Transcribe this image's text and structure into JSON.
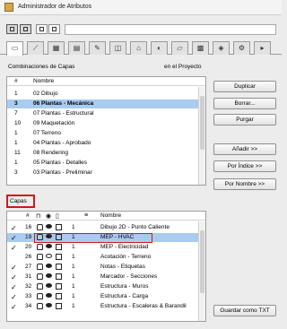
{
  "window": {
    "title": "Administrador de Atributos"
  },
  "toolbar": {
    "search_value": ""
  },
  "combinations": {
    "section_title": "Combinaciones de Capas",
    "in_project": "en el Proyecto",
    "header_hash": "#",
    "header_name": "Nombre",
    "rows": [
      {
        "num": "1",
        "name": "02 Dibujo"
      },
      {
        "num": "3",
        "name": "06 Plantas - Mecánica"
      },
      {
        "num": "7",
        "name": "07 Plantas - Estructural"
      },
      {
        "num": "10",
        "name": "09 Maquetación"
      },
      {
        "num": "1",
        "name": "07 Terreno"
      },
      {
        "num": "1",
        "name": "04 Plantas - Aprobado"
      },
      {
        "num": "11",
        "name": "08 Rendering"
      },
      {
        "num": "1",
        "name": "05 Plantas - Detalles"
      },
      {
        "num": "3",
        "name": "03 Plantas - Preliminar"
      }
    ]
  },
  "buttons": {
    "duplicar": "Duplicar",
    "borrar": "Borrar...",
    "purgar": "Purgar",
    "anadir": "Añadir >>",
    "por_indice": "Por Índice >>",
    "por_nombre": "Por Nombre >>",
    "guardar_txt": "Guardar como TXT"
  },
  "layers": {
    "section_title": "Capas",
    "header_hash": "#",
    "header_name": "Nombre",
    "rows": [
      {
        "check": "✓",
        "num": "16",
        "count": "1",
        "name": "Dibujo 2D - Punto Caliente"
      },
      {
        "check": "✓",
        "num": "19",
        "count": "1",
        "name": "MEP - HVAC"
      },
      {
        "check": "✓",
        "num": "20",
        "count": "1",
        "name": "MEP - Electricidad"
      },
      {
        "check": "",
        "num": "26",
        "count": "1",
        "name": "Acotación - Terreno"
      },
      {
        "check": "✓",
        "num": "27",
        "count": "1",
        "name": "Notas - Etiquetas"
      },
      {
        "check": "✓",
        "num": "31",
        "count": "1",
        "name": "Marcador - Secciones"
      },
      {
        "check": "✓",
        "num": "32",
        "count": "1",
        "name": "Estructura - Muros"
      },
      {
        "check": "✓",
        "num": "33",
        "count": "1",
        "name": "Estructura - Carga"
      },
      {
        "check": "✓",
        "num": "34",
        "count": "1",
        "name": "Estructura - Escaleras & Barandil"
      }
    ]
  }
}
